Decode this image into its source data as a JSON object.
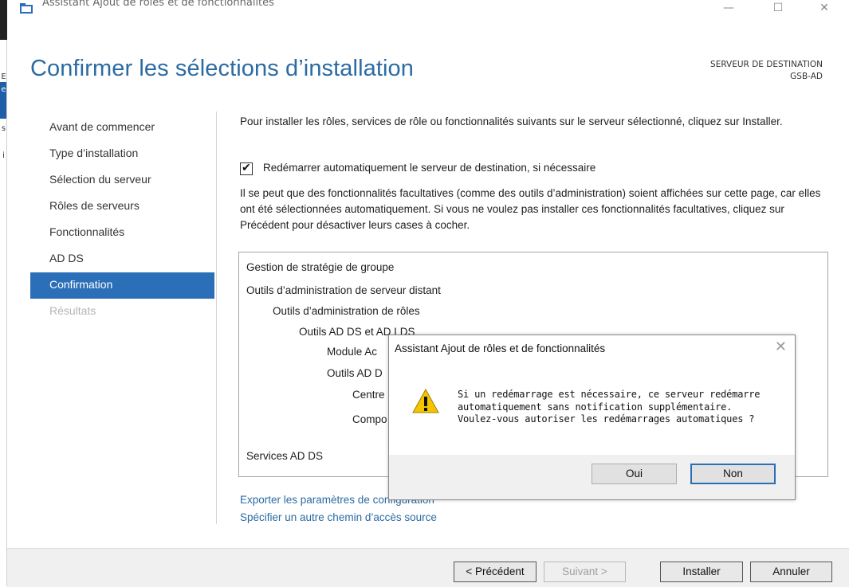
{
  "window": {
    "title": "Assistant Ajout de rôles et de fonctionnalités",
    "minimize": "—",
    "maximize": "☐",
    "close": "✕"
  },
  "edge_chars": [
    "E",
    "e",
    "s",
    "i"
  ],
  "header": {
    "title": "Confirmer les sélections d’installation",
    "destination_label": "SERVEUR DE DESTINATION",
    "destination_server": "GSB-AD"
  },
  "sidebar": {
    "items": [
      {
        "label": "Avant de commencer",
        "state": "normal"
      },
      {
        "label": "Type d’installation",
        "state": "normal"
      },
      {
        "label": "Sélection du serveur",
        "state": "normal"
      },
      {
        "label": "Rôles de serveurs",
        "state": "normal"
      },
      {
        "label": "Fonctionnalités",
        "state": "normal"
      },
      {
        "label": "AD DS",
        "state": "normal"
      },
      {
        "label": "Confirmation",
        "state": "active"
      },
      {
        "label": "Résultats",
        "state": "disabled"
      }
    ]
  },
  "main": {
    "intro": "Pour installer les rôles, services de rôle ou fonctionnalités suivants sur le serveur sélectionné, cliquez sur Installer.",
    "restart_checkbox": {
      "label": "Redémarrer automatiquement le serveur de destination, si nécessaire",
      "checked": true
    },
    "optional_note": "Il se peut que des fonctionnalités facultatives (comme des outils d’administration) soient affichées sur cette page, car elles ont été sélectionnées automatiquement. Si vous ne voulez pas installer ces fonctionnalités facultatives, cliquez sur Précédent pour désactiver leurs cases à cocher.",
    "features": [
      "Gestion de stratégie de groupe",
      "Outils d’administration de serveur distant",
      "Outils d’administration de rôles",
      "Outils AD DS et AD LDS",
      "Module Ac",
      "Outils AD D",
      "Centre",
      "Compo",
      "Services AD DS"
    ],
    "export_link": "Exporter les paramètres de configuration",
    "source_link": "Spécifier un autre chemin d’accès source"
  },
  "footer": {
    "previous": "< Précédent",
    "next": "Suivant >",
    "install": "Installer",
    "cancel": "Annuler"
  },
  "dialog": {
    "title": "Assistant Ajout de rôles et de fonctionnalités",
    "close": "✕",
    "message_lines": [
      "Si un redémarrage est nécessaire, ce serveur redémarre",
      "automatiquement sans notification supplémentaire.",
      "Voulez-vous autoriser les redémarrages automatiques ?"
    ],
    "yes": "Oui",
    "no": "Non"
  },
  "colors": {
    "accent": "#2a6fb7",
    "title_blue": "#2b6ba4",
    "link_blue": "#2b6ba4",
    "footer_bg": "#f0f0f0",
    "warning_yellow": "#f4c400"
  }
}
